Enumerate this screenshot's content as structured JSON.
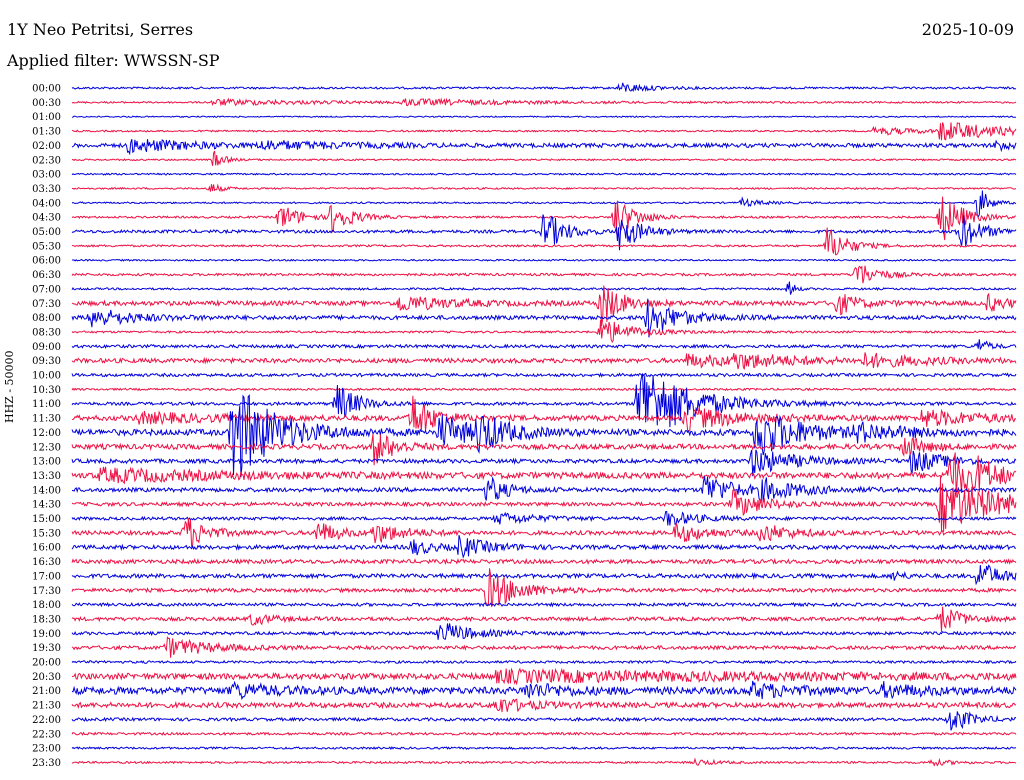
{
  "header": {
    "station": "1Y Neo Petritsi, Serres",
    "date": "2025-10-09",
    "filter": "Applied filter: WWSSN-SP"
  },
  "y_axis_label": "HHZ - 50000",
  "colors": {
    "blue": "#0000dd",
    "red": "#ee1144"
  },
  "chart_data": {
    "type": "line",
    "description_type": "helicorder",
    "channel": "HHZ",
    "row_labels": [
      "00:00",
      "00:30",
      "01:00",
      "01:30",
      "02:00",
      "02:30",
      "03:00",
      "03:30",
      "04:00",
      "04:30",
      "05:00",
      "05:30",
      "06:00",
      "06:30",
      "07:00",
      "07:30",
      "08:00",
      "08:30",
      "09:00",
      "09:30",
      "10:00",
      "10:30",
      "11:00",
      "11:30",
      "12:00",
      "12:30",
      "13:00",
      "13:30",
      "14:00",
      "14:30",
      "15:00",
      "15:30",
      "16:00",
      "16:30",
      "17:00",
      "17:30",
      "18:00",
      "18:30",
      "19:00",
      "19:30",
      "20:00",
      "20:30",
      "21:00",
      "21:30",
      "22:00",
      "22:30",
      "23:00",
      "23:30"
    ],
    "row_color_order": [
      "blue",
      "red"
    ],
    "row_noise": [
      1,
      0.8,
      0.6,
      0.8,
      2,
      0.8,
      0.8,
      0.8,
      0.8,
      1,
      1.5,
      1,
      0.8,
      1.2,
      1,
      2.2,
      2,
      1,
      1.5,
      2.2,
      1.5,
      1,
      1.5,
      2.5,
      3,
      2.5,
      2,
      3,
      2,
      1.8,
      1.5,
      2,
      2,
      2,
      2,
      1.8,
      1.5,
      1.8,
      1.5,
      1.8,
      1.2,
      3,
      3.5,
      2.5,
      1.5,
      1.2,
      1,
      1
    ],
    "events": [
      {
        "row": 0,
        "t": 0.58,
        "amp": 5,
        "dur": 0.03
      },
      {
        "row": 1,
        "t": 0.15,
        "amp": 3,
        "dur": 0.1
      },
      {
        "row": 1,
        "t": 0.35,
        "amp": 3,
        "dur": 0.12
      },
      {
        "row": 3,
        "t": 0.92,
        "amp": 10,
        "dur": 0.06
      },
      {
        "row": 3,
        "t": 0.85,
        "amp": 4,
        "dur": 0.05
      },
      {
        "row": 4,
        "t": 0.06,
        "amp": 7,
        "dur": 0.06
      },
      {
        "row": 4,
        "t": 0.2,
        "amp": 4,
        "dur": 0.08
      },
      {
        "row": 4,
        "t": 0.98,
        "amp": 7,
        "dur": 0.01
      },
      {
        "row": 5,
        "t": 0.15,
        "amp": 9,
        "dur": 0.01
      },
      {
        "row": 7,
        "t": 0.147,
        "amp": 6,
        "dur": 0.01
      },
      {
        "row": 8,
        "t": 0.71,
        "amp": 4,
        "dur": 0.02
      },
      {
        "row": 8,
        "t": 0.96,
        "amp": 18,
        "dur": 0.01
      },
      {
        "row": 9,
        "t": 0.22,
        "amp": 14,
        "dur": 0.02
      },
      {
        "row": 9,
        "t": 0.275,
        "amp": 16,
        "dur": 0.02
      },
      {
        "row": 9,
        "t": 0.575,
        "amp": 22,
        "dur": 0.02
      },
      {
        "row": 9,
        "t": 0.92,
        "amp": 28,
        "dur": 0.02
      },
      {
        "row": 10,
        "t": 0.5,
        "amp": 22,
        "dur": 0.02
      },
      {
        "row": 10,
        "t": 0.58,
        "amp": 20,
        "dur": 0.02
      },
      {
        "row": 10,
        "t": 0.94,
        "amp": 20,
        "dur": 0.02
      },
      {
        "row": 11,
        "t": 0.8,
        "amp": 20,
        "dur": 0.02
      },
      {
        "row": 13,
        "t": 0.83,
        "amp": 15,
        "dur": 0.02
      },
      {
        "row": 14,
        "t": 0.76,
        "amp": 10,
        "dur": 0.005
      },
      {
        "row": 15,
        "t": 0.345,
        "amp": 8,
        "dur": 0.05
      },
      {
        "row": 15,
        "t": 0.56,
        "amp": 24,
        "dur": 0.02
      },
      {
        "row": 15,
        "t": 0.81,
        "amp": 12,
        "dur": 0.02
      },
      {
        "row": 15,
        "t": 0.97,
        "amp": 8,
        "dur": 0.02
      },
      {
        "row": 16,
        "t": 0.02,
        "amp": 10,
        "dur": 0.04
      },
      {
        "row": 16,
        "t": 0.61,
        "amp": 20,
        "dur": 0.03
      },
      {
        "row": 17,
        "t": 0.56,
        "amp": 15,
        "dur": 0.03
      },
      {
        "row": 18,
        "t": 0.96,
        "amp": 8,
        "dur": 0.01
      },
      {
        "row": 19,
        "t": 0.65,
        "amp": 6,
        "dur": 0.06
      },
      {
        "row": 19,
        "t": 0.7,
        "amp": 6,
        "dur": 0.06
      },
      {
        "row": 19,
        "t": 0.84,
        "amp": 6,
        "dur": 0.06
      },
      {
        "row": 22,
        "t": 0.28,
        "amp": 22,
        "dur": 0.02
      },
      {
        "row": 22,
        "t": 0.6,
        "amp": 45,
        "dur": 0.05
      },
      {
        "row": 23,
        "t": 0.07,
        "amp": 5,
        "dur": 0.08
      },
      {
        "row": 23,
        "t": 0.36,
        "amp": 25,
        "dur": 0.02
      },
      {
        "row": 23,
        "t": 0.65,
        "amp": 12,
        "dur": 0.05
      },
      {
        "row": 23,
        "t": 0.9,
        "amp": 8,
        "dur": 0.06
      },
      {
        "row": 24,
        "t": 0.17,
        "amp": 55,
        "dur": 0.04
      },
      {
        "row": 24,
        "t": 0.39,
        "amp": 18,
        "dur": 0.03
      },
      {
        "row": 24,
        "t": 0.43,
        "amp": 18,
        "dur": 0.03
      },
      {
        "row": 24,
        "t": 0.725,
        "amp": 28,
        "dur": 0.04
      },
      {
        "row": 24,
        "t": 0.83,
        "amp": 8,
        "dur": 0.05
      },
      {
        "row": 25,
        "t": 0.32,
        "amp": 18,
        "dur": 0.02
      },
      {
        "row": 25,
        "t": 0.88,
        "amp": 12,
        "dur": 0.02
      },
      {
        "row": 26,
        "t": 0.72,
        "amp": 14,
        "dur": 0.04
      },
      {
        "row": 26,
        "t": 0.89,
        "amp": 12,
        "dur": 0.03
      },
      {
        "row": 27,
        "t": 0.03,
        "amp": 6,
        "dur": 0.12
      },
      {
        "row": 27,
        "t": 0.93,
        "amp": 25,
        "dur": 0.03
      },
      {
        "row": 27,
        "t": 0.96,
        "amp": 10,
        "dur": 0.02
      },
      {
        "row": 28,
        "t": 0.44,
        "amp": 14,
        "dur": 0.02
      },
      {
        "row": 28,
        "t": 0.67,
        "amp": 16,
        "dur": 0.03
      },
      {
        "row": 28,
        "t": 0.73,
        "amp": 10,
        "dur": 0.04
      },
      {
        "row": 29,
        "t": 0.7,
        "amp": 14,
        "dur": 0.03
      },
      {
        "row": 29,
        "t": 0.92,
        "amp": 28,
        "dur": 0.06
      },
      {
        "row": 30,
        "t": 0.45,
        "amp": 6,
        "dur": 0.04
      },
      {
        "row": 30,
        "t": 0.63,
        "amp": 8,
        "dur": 0.03
      },
      {
        "row": 31,
        "t": 0.12,
        "amp": 18,
        "dur": 0.02
      },
      {
        "row": 31,
        "t": 0.26,
        "amp": 12,
        "dur": 0.02
      },
      {
        "row": 31,
        "t": 0.32,
        "amp": 10,
        "dur": 0.03
      },
      {
        "row": 31,
        "t": 0.64,
        "amp": 10,
        "dur": 0.03
      },
      {
        "row": 31,
        "t": 0.73,
        "amp": 9,
        "dur": 0.03
      },
      {
        "row": 32,
        "t": 0.36,
        "amp": 8,
        "dur": 0.02
      },
      {
        "row": 32,
        "t": 0.41,
        "amp": 10,
        "dur": 0.03
      },
      {
        "row": 34,
        "t": 0.87,
        "amp": 5,
        "dur": 0.01
      },
      {
        "row": 34,
        "t": 0.96,
        "amp": 16,
        "dur": 0.02
      },
      {
        "row": 35,
        "t": 0.44,
        "amp": 22,
        "dur": 0.03
      },
      {
        "row": 37,
        "t": 0.19,
        "amp": 6,
        "dur": 0.02
      },
      {
        "row": 37,
        "t": 0.92,
        "amp": 14,
        "dur": 0.02
      },
      {
        "row": 38,
        "t": 0.39,
        "amp": 12,
        "dur": 0.03
      },
      {
        "row": 39,
        "t": 0.1,
        "amp": 10,
        "dur": 0.04
      },
      {
        "row": 41,
        "t": 0.45,
        "amp": 5,
        "dur": 0.3
      },
      {
        "row": 42,
        "t": 0.17,
        "amp": 7,
        "dur": 0.04
      },
      {
        "row": 42,
        "t": 0.48,
        "amp": 7,
        "dur": 0.04
      },
      {
        "row": 42,
        "t": 0.72,
        "amp": 7,
        "dur": 0.04
      },
      {
        "row": 42,
        "t": 0.86,
        "amp": 6,
        "dur": 0.04
      },
      {
        "row": 43,
        "t": 0.45,
        "amp": 8,
        "dur": 0.03
      },
      {
        "row": 44,
        "t": 0.93,
        "amp": 14,
        "dur": 0.02
      },
      {
        "row": 47,
        "t": 0.66,
        "amp": 3,
        "dur": 0.02
      },
      {
        "row": 47,
        "t": 0.91,
        "amp": 3,
        "dur": 0.02
      }
    ]
  }
}
